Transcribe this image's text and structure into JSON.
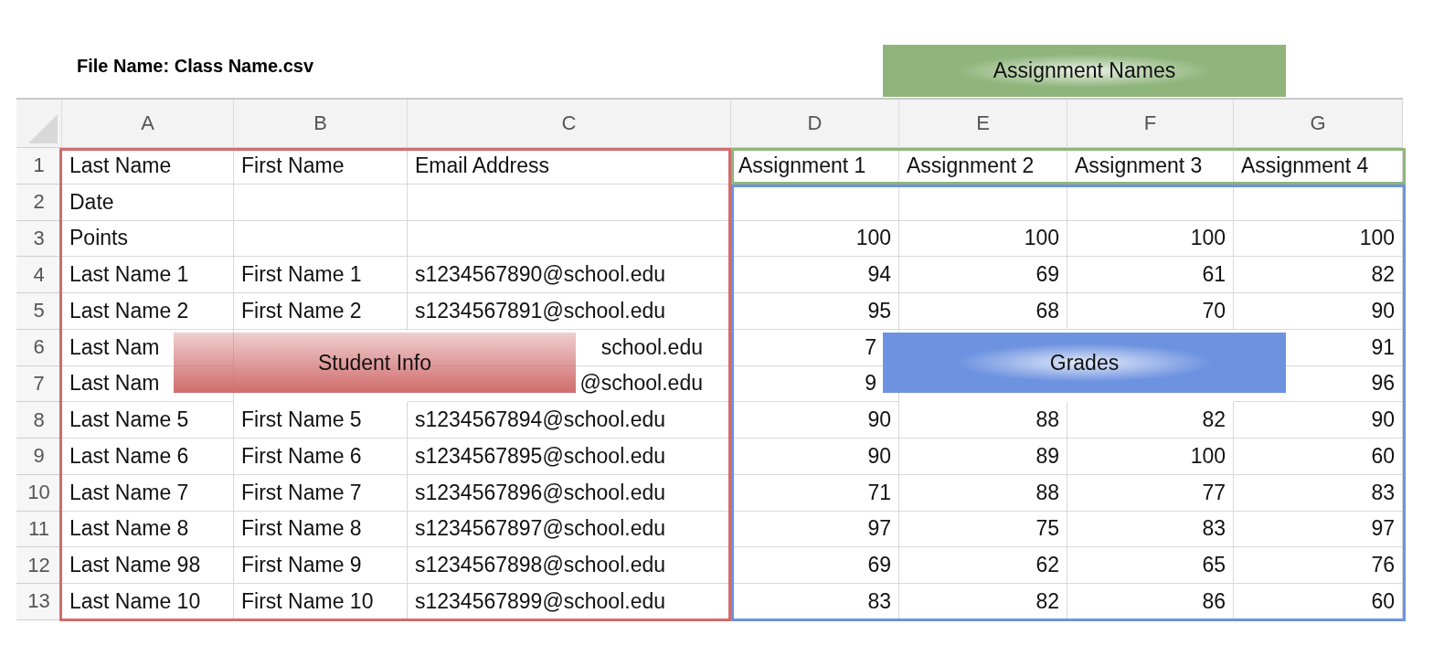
{
  "file_name": "File Name: Class Name.csv",
  "columns": [
    "A",
    "B",
    "C",
    "D",
    "E",
    "F",
    "G"
  ],
  "rows": [
    {
      "number": "1",
      "cells": [
        "Last Name",
        "First Name",
        "Email Address",
        "Assignment 1",
        "Assignment 2",
        "Assignment 3",
        "Assignment 4"
      ]
    },
    {
      "number": "2",
      "cells": [
        "Date",
        null,
        null,
        null,
        null,
        null,
        null
      ]
    },
    {
      "number": "3",
      "cells": [
        "Points",
        null,
        null,
        "100",
        "100",
        "100",
        "100"
      ]
    },
    {
      "number": "4",
      "cells": [
        "Last Name 1",
        "First Name 1",
        "s1234567890@school.edu",
        "94",
        "69",
        "61",
        "82"
      ]
    },
    {
      "number": "5",
      "cells": [
        "Last Name 2",
        "First Name 2",
        "s1234567891@school.edu",
        "95",
        "68",
        "70",
        "90"
      ]
    },
    {
      "number": "6",
      "cells": [
        "Last Nam",
        null,
        "school.edu",
        "7",
        null,
        null,
        "91"
      ]
    },
    {
      "number": "7",
      "cells": [
        "Last Nam",
        null,
        "@school.edu",
        "9",
        null,
        null,
        "96"
      ]
    },
    {
      "number": "8",
      "cells": [
        "Last Name 5",
        "First Name 5",
        "s1234567894@school.edu",
        "90",
        "88",
        "82",
        "90"
      ]
    },
    {
      "number": "9",
      "cells": [
        "Last Name 6",
        "First Name 6",
        "s1234567895@school.edu",
        "90",
        "89",
        "100",
        "60"
      ]
    },
    {
      "number": "10",
      "cells": [
        "Last Name 7",
        "First Name 7",
        "s1234567896@school.edu",
        "71",
        "88",
        "77",
        "83"
      ]
    },
    {
      "number": "11",
      "cells": [
        "Last Name 8",
        "First Name 8",
        "s1234567897@school.edu",
        "97",
        "75",
        "83",
        "97"
      ]
    },
    {
      "number": "12",
      "cells": [
        "Last Name 98",
        "First Name 9",
        "s1234567898@school.edu",
        "69",
        "62",
        "65",
        "76"
      ]
    },
    {
      "number": "13",
      "cells": [
        "Last Name 10",
        "First Name 10",
        "s1234567899@school.edu",
        "83",
        "82",
        "86",
        "60"
      ]
    }
  ],
  "annotations": [
    {
      "label": "Assignment Names",
      "color": "#8fb57c"
    },
    {
      "label": "Student Info",
      "color": "#d06c6c"
    },
    {
      "label": "Grades",
      "color": "#6d92e0"
    }
  ]
}
